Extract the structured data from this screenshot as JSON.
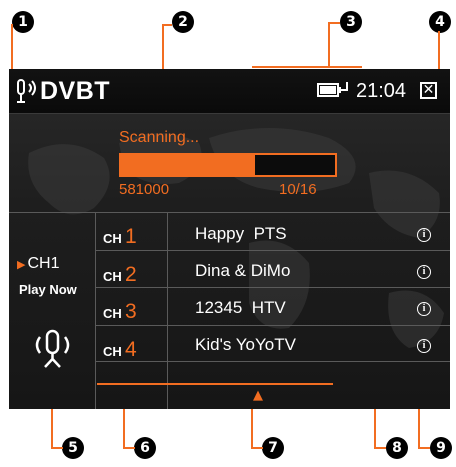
{
  "header": {
    "app_title": "DVBT",
    "clock": "21:04",
    "close_glyph": "✕",
    "icons": [
      "signal-antenna-icon",
      "battery-plug-icon",
      "close-icon"
    ]
  },
  "scan": {
    "label": "Scanning...",
    "frequency": "581000",
    "progress_text": "10/16",
    "progress_fraction": 0.625
  },
  "current_channel": {
    "label": "CH1",
    "action": "Play Now",
    "icon": "antenna-icon"
  },
  "channels": [
    {
      "prefix": "CH",
      "number": "1",
      "name": "Happy  PTS",
      "info_glyph": "i"
    },
    {
      "prefix": "CH",
      "number": "2",
      "name": "Dina & DiMo",
      "info_glyph": "i"
    },
    {
      "prefix": "CH",
      "number": "3",
      "name": "12345  HTV",
      "info_glyph": "i"
    },
    {
      "prefix": "CH",
      "number": "4",
      "name": "Kid's YoYoTV",
      "info_glyph": "i"
    }
  ],
  "callouts": [
    "1",
    "2",
    "3",
    "4",
    "5",
    "6",
    "7",
    "8",
    "9"
  ],
  "colors": {
    "accent": "#f26d21",
    "screen_bg": "#1e1e1e",
    "text": "#ffffff"
  }
}
